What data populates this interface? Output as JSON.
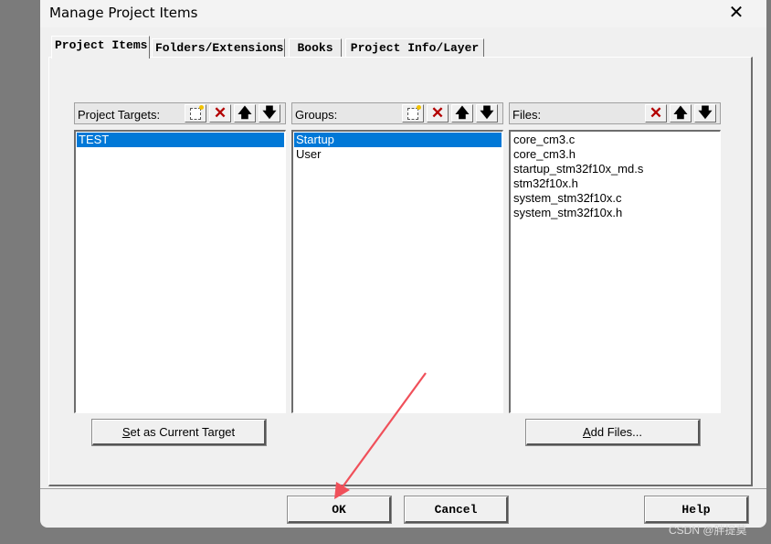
{
  "window": {
    "title": "Manage Project Items",
    "close_symbol": "✕"
  },
  "tabs": [
    {
      "label": "Project Items",
      "active": true
    },
    {
      "label": "Folders/Extensions",
      "active": false
    },
    {
      "label": "Books",
      "active": false
    },
    {
      "label": "Project Info/Layer",
      "active": false
    }
  ],
  "targets": {
    "label": "Project Targets:",
    "items": [
      "TEST"
    ],
    "selected_index": 0
  },
  "groups": {
    "label": "Groups:",
    "items": [
      "Startup",
      "User"
    ],
    "selected_index": 0
  },
  "files": {
    "label": "Files:",
    "items": [
      "core_cm3.c",
      "core_cm3.h",
      "startup_stm32f10x_md.s",
      "stm32f10x.h",
      "system_stm32f10x.c",
      "system_stm32f10x.h"
    ]
  },
  "buttons": {
    "set_target_key": "S",
    "set_target_rest": "et as Current Target",
    "add_files_key": "A",
    "add_files_rest": "dd Files...",
    "ok": "OK",
    "cancel": "Cancel",
    "help": "Help"
  },
  "toolbar": {
    "delete_symbol": "✕",
    "up_symbol": "🡅",
    "down_symbol": "🡇"
  },
  "watermark": "CSDN @胖提莫",
  "colors": {
    "selection": "#0078d7",
    "delete_icon": "#b30000",
    "annotation_arrow": "#f0505a"
  }
}
